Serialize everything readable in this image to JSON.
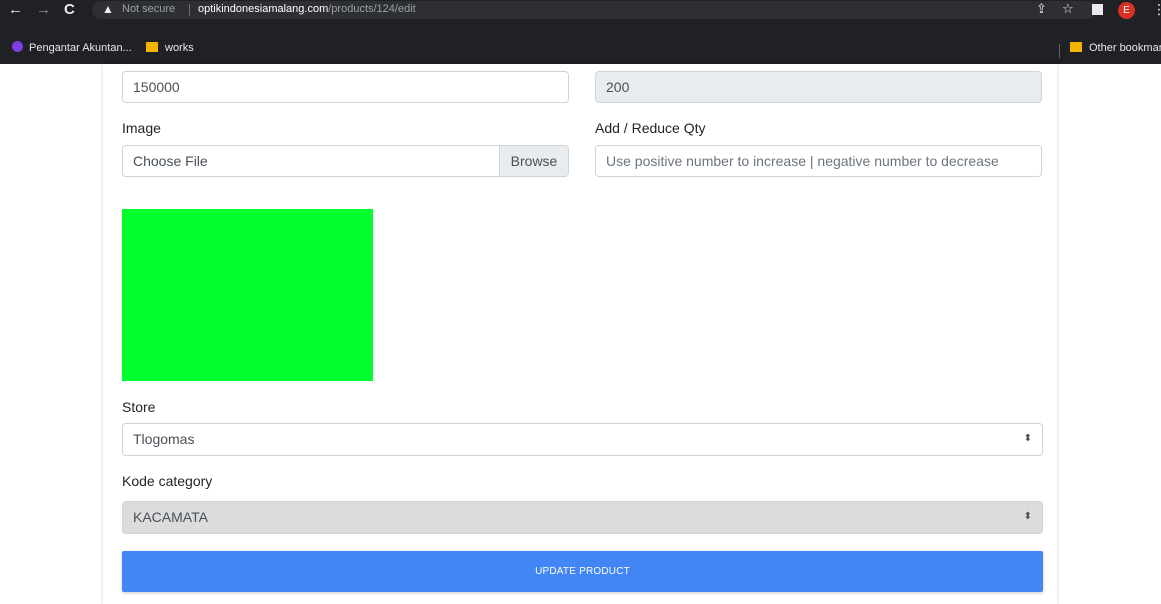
{
  "browser": {
    "security_label": "Not secure",
    "url_domain": "optikindonesiamalang.com",
    "url_path": "/products/124/edit",
    "avatar_initial": "E",
    "bookmarks": [
      {
        "label": "Pengantar Akuntan..."
      },
      {
        "label": "works"
      },
      {
        "label": "Other bookmark"
      }
    ]
  },
  "form": {
    "price_value": "150000",
    "stock_value": "200",
    "image_label": "Image",
    "file_placeholder": "Choose File",
    "browse_label": "Browse",
    "qty_label": "Add / Reduce Qty",
    "qty_placeholder": "Use positive number to increase | negative number to decrease",
    "store_label": "Store",
    "store_value": "Tlogomas",
    "category_label": "Kode category",
    "category_value": "KACAMATA",
    "submit_label": "UPDATE PRODUCT"
  },
  "colors": {
    "preview_image": "#00ff2d",
    "primary_button": "#4285f4"
  }
}
